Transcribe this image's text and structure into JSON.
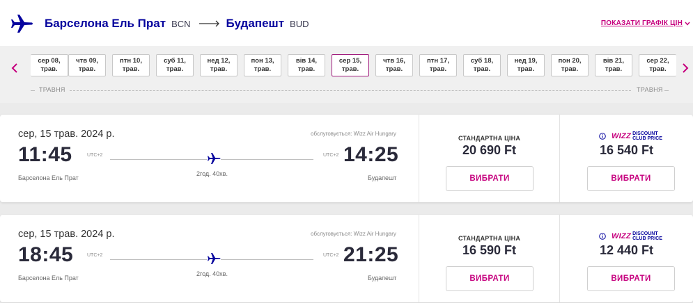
{
  "header": {
    "origin_city": "Барселона Ель Прат",
    "origin_code": "BCN",
    "destination_city": "Будапешт",
    "destination_code": "BUD",
    "price_chart_link": "ПОКАЗАТИ ГРАФІК ЦІН"
  },
  "dates": [
    {
      "day": "сер 08,",
      "month": "трав."
    },
    {
      "day": "чтв 09,",
      "month": "трав."
    },
    {
      "day": "птн 10,",
      "month": "трав."
    },
    {
      "day": "суб 11,",
      "month": "трав."
    },
    {
      "day": "нед 12,",
      "month": "трав."
    },
    {
      "day": "пон 13,",
      "month": "трав."
    },
    {
      "day": "вів 14,",
      "month": "трав."
    },
    {
      "day": "сер 15,",
      "month": "трав.",
      "selected": true
    },
    {
      "day": "чтв 16,",
      "month": "трав."
    },
    {
      "day": "птн 17,",
      "month": "трав."
    },
    {
      "day": "суб 18,",
      "month": "трав."
    },
    {
      "day": "нед 19,",
      "month": "трав."
    },
    {
      "day": "пон 20,",
      "month": "трав."
    },
    {
      "day": "вів 21,",
      "month": "трав."
    },
    {
      "day": "сер 22,",
      "month": "трав."
    }
  ],
  "month_label_left": "ТРАВНЯ",
  "month_label_right": "ТРАВНЯ",
  "flights": [
    {
      "date": "сер, 15 трав. 2024 р.",
      "operated_by": "обслуговується: Wizz Air Hungary",
      "departure_time": "11:45",
      "arrival_time": "14:25",
      "departure_utc": "UTC+2",
      "arrival_utc": "UTC+2",
      "duration": "2год. 40хв.",
      "departure_city": "Барселона Ель Прат",
      "arrival_city": "Будапешт",
      "standard_label": "СТАНДАРТНА ЦІНА",
      "standard_price": "20 690 Ft",
      "club_price": "16 540 Ft",
      "select_label": "ВИБРАТИ"
    },
    {
      "date": "сер, 15 трав. 2024 р.",
      "operated_by": "обслуговується: Wizz Air Hungary",
      "departure_time": "18:45",
      "arrival_time": "21:25",
      "departure_utc": "UTC+2",
      "arrival_utc": "UTC+2",
      "duration": "2год. 40хв.",
      "departure_city": "Барселона Ель Прат",
      "arrival_city": "Будапешт",
      "standard_label": "СТАНДАРТНА ЦІНА",
      "standard_price": "16 590 Ft",
      "club_price": "12 440 Ft",
      "select_label": "ВИБРАТИ"
    }
  ],
  "club_badge": {
    "logo_text": "WIZZ",
    "line1": "DISCOUNT",
    "line2": "CLUB PRICE"
  },
  "colors": {
    "brand_navy": "#06049e",
    "brand_magenta": "#c6007e",
    "selected_border": "#a01a7d"
  },
  "icons": {
    "logo": "airplane-icon",
    "route_arrow": "long-arrow-right-icon",
    "chart_link": "chevron-down-icon",
    "nav_prev": "chevron-left-icon",
    "nav_next": "chevron-right-icon",
    "track": "airplane-icon",
    "club_info": "info-icon"
  }
}
